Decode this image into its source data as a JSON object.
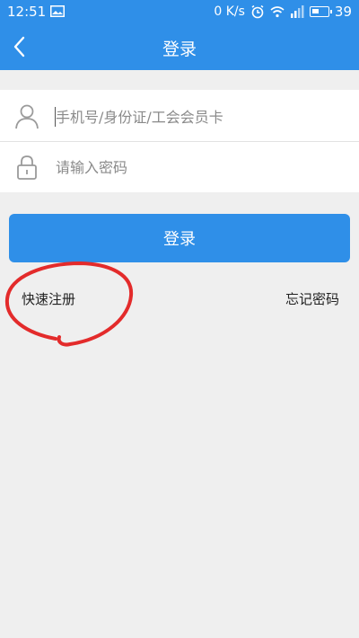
{
  "status_bar": {
    "time": "12:51",
    "network_speed": "0 K/s",
    "battery_level": "39",
    "icons": [
      "image-notification-icon",
      "alarm-icon",
      "wifi-icon",
      "signal-icon",
      "battery-icon"
    ]
  },
  "header": {
    "title": "登录",
    "back_icon": "chevron-left-icon"
  },
  "form": {
    "account": {
      "placeholder": "手机号/身份证/工会会员卡",
      "value": "",
      "icon": "user-icon"
    },
    "password": {
      "placeholder": "请输入密码",
      "value": "",
      "icon": "lock-icon"
    }
  },
  "actions": {
    "login_label": "登录",
    "register_label": "快速注册",
    "forgot_label": "忘记密码"
  },
  "colors": {
    "primary": "#2f8fe8",
    "background": "#efefef",
    "annotation": "#e32b2b"
  }
}
